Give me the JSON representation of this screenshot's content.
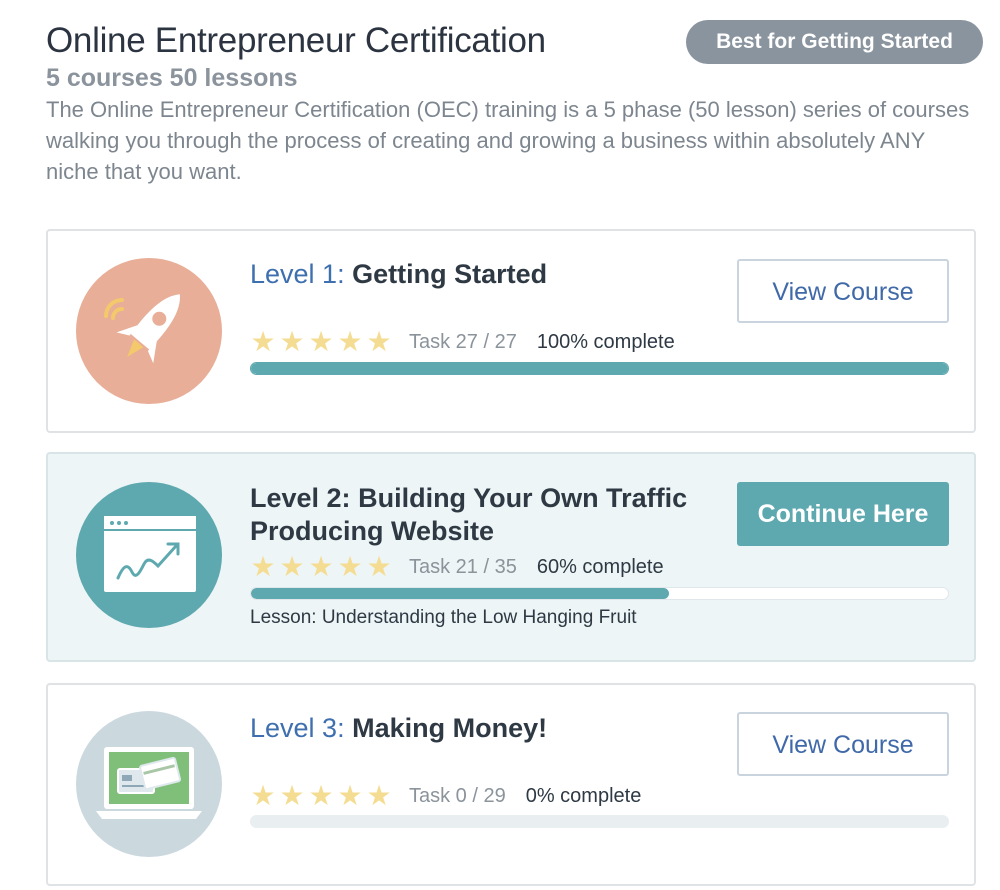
{
  "program": {
    "title": "Online Entrepreneur Certification",
    "subtitle": "5 courses 50 lessons",
    "description": "The Online Entrepreneur Certification (OEC) training is a 5 phase (50 lesson) series of courses walking you through the process of creating and growing a business within absolutely ANY niche that you want.",
    "badge": "Best for Getting Started"
  },
  "courses": [
    {
      "level_label": "Level 1:",
      "name": "Getting Started",
      "icon": "rocket-icon",
      "rating_stars": 5,
      "task_text": "Task 27 / 27",
      "complete_text": "100% complete",
      "progress": 1.0,
      "button_label": "View Course"
    },
    {
      "level_label": "Level 2:",
      "name": "Building Your Own Traffic Producing Website",
      "icon": "website-chart-icon",
      "rating_stars": 5,
      "task_text": "Task 21 / 35",
      "complete_text": "60% complete",
      "progress": 0.6,
      "button_label": "Continue Here",
      "lesson_text": "Lesson: Understanding the Low Hanging Fruit"
    },
    {
      "level_label": "Level 3:",
      "name": "Making Money!",
      "icon": "laptop-payment-icon",
      "rating_stars": 5,
      "task_text": "Task 0 / 29",
      "complete_text": "0% complete",
      "progress": 0,
      "button_label": "View Course"
    }
  ],
  "colors": {
    "accent": "#5ea8b0",
    "link": "#3e6fae",
    "star": "#f4dd93",
    "badge": "#8a949e"
  }
}
